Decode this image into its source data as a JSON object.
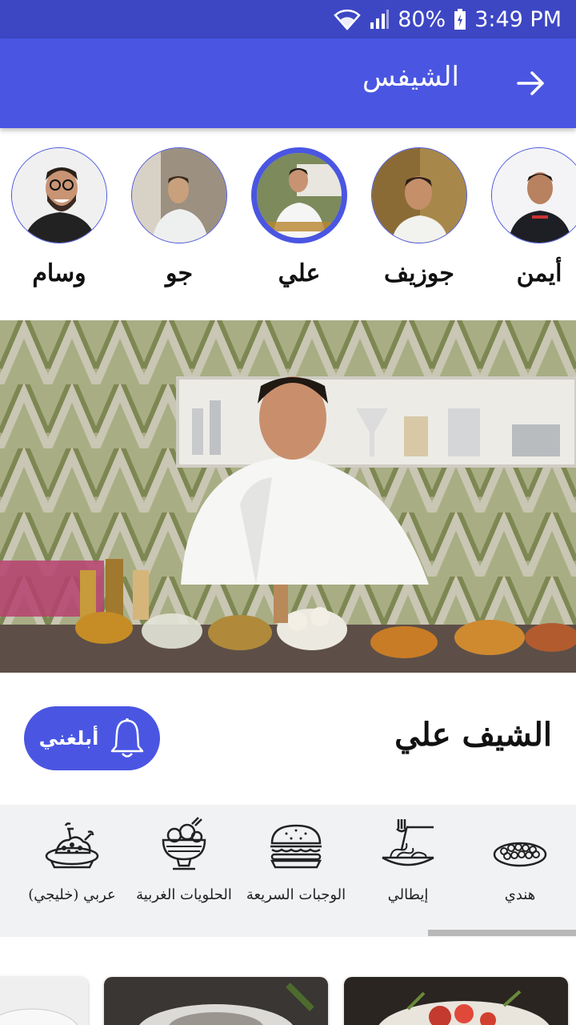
{
  "status_bar": {
    "battery": "80%",
    "time": "3:49 PM"
  },
  "app_bar": {
    "title": "الشيفس"
  },
  "chefs": [
    {
      "name": "أيمن"
    },
    {
      "name": "جوزيف"
    },
    {
      "name": "علي",
      "selected": true
    },
    {
      "name": "جو"
    },
    {
      "name": "وسام"
    }
  ],
  "chef_detail": {
    "title": "الشيف علي",
    "notify_label": "أبلغني"
  },
  "categories": [
    {
      "label": "هندي",
      "icon": "lentils-bowl-icon"
    },
    {
      "label": "إيطالي",
      "icon": "spaghetti-icon"
    },
    {
      "label": "الوجبات السريعة",
      "icon": "burger-icon"
    },
    {
      "label": "الحلويات الغربية",
      "icon": "ice-cream-cup-icon"
    },
    {
      "label": "عربي (خليجي)",
      "icon": "platter-icon"
    }
  ],
  "colors": {
    "primary": "#4a56e2",
    "status_bar": "#3d47c4",
    "category_bg": "#f1f2f4"
  }
}
